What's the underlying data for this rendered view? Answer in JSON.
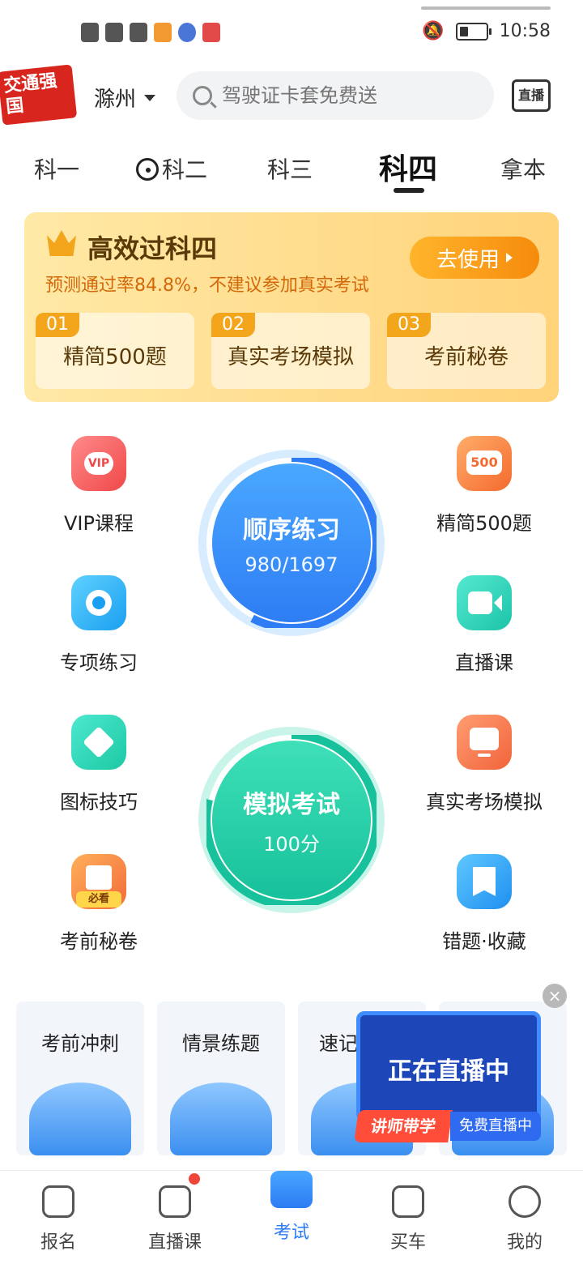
{
  "status_bar": {
    "time": "10:58"
  },
  "header": {
    "logo_text": "交通强国",
    "city": "滁州",
    "search_placeholder": "驾驶证卡套免费送",
    "live_label": "直播"
  },
  "tabs": [
    {
      "label": "科一"
    },
    {
      "label": "科二"
    },
    {
      "label": "科三"
    },
    {
      "label": "科四",
      "active": true
    },
    {
      "label": "拿本"
    }
  ],
  "promo": {
    "title": "高效过科四",
    "subtitle": "预测通过率84.8%，不建议参加真实考试",
    "button": "去使用",
    "steps": [
      {
        "num": "01",
        "label": "精简500题"
      },
      {
        "num": "02",
        "label": "真实考场模拟"
      },
      {
        "num": "03",
        "label": "考前秘卷"
      }
    ]
  },
  "features_left": [
    {
      "label": "VIP课程",
      "icon": "vip-icon"
    },
    {
      "label": "专项练习",
      "icon": "target-icon"
    },
    {
      "label": "图标技巧",
      "icon": "sign-icon"
    },
    {
      "label": "考前秘卷",
      "icon": "clipboard-icon",
      "badge": "必看"
    }
  ],
  "features_right": [
    {
      "label": "精简500题",
      "icon": "500-icon",
      "badge": "500"
    },
    {
      "label": "直播课",
      "icon": "video-icon"
    },
    {
      "label": "真实考场模拟",
      "icon": "monitor-icon"
    },
    {
      "label": "错题·收藏",
      "icon": "bookmark-icon"
    }
  ],
  "practice": {
    "title": "顺序练习",
    "progress": "980/1697"
  },
  "mock_exam": {
    "title": "模拟考试",
    "score": "100分"
  },
  "cards": [
    {
      "label": "考前冲刺"
    },
    {
      "label": "情景练题"
    },
    {
      "label": "速记"
    }
  ],
  "live_popup": {
    "title": "正在直播中",
    "tag1": "讲师带学",
    "tag2": "免费直播中",
    "close": "×"
  },
  "bottom_nav": [
    {
      "label": "报名"
    },
    {
      "label": "直播课"
    },
    {
      "label": "考试",
      "active": true
    },
    {
      "label": "买车"
    },
    {
      "label": "我的"
    }
  ],
  "colors": {
    "accent": "#2d7cf4",
    "green": "#17c19b",
    "orange": "#f68b0c"
  }
}
